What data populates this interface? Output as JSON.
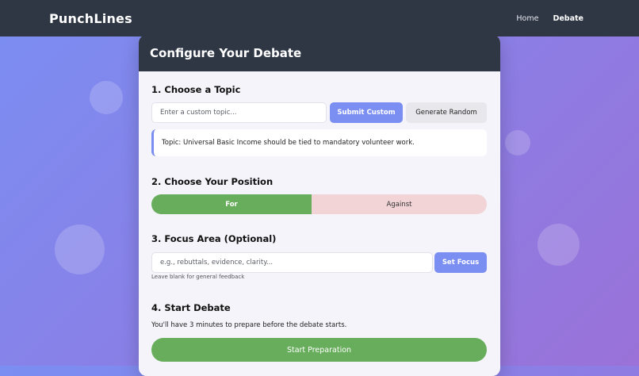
{
  "app": {
    "brand": "PunchLines",
    "nav": [
      {
        "label": "Home"
      },
      {
        "label": "Debate"
      }
    ]
  },
  "card": {
    "title": "Configure Your Debate",
    "topic_section": {
      "title": "1. Choose a Topic",
      "input_placeholder": "Enter a custom topic...",
      "input_value": "",
      "submit_label": "Submit Custom",
      "random_label": "Generate Random",
      "current_topic": "Topic: Universal Basic Income should be tied to mandatory volunteer work."
    },
    "position_section": {
      "title": "2. Choose Your Position",
      "for_label": "For",
      "against_label": "Against",
      "selected": "For"
    },
    "focus_section": {
      "title": "3. Focus Area (Optional)",
      "input_placeholder": "e.g., rebuttals, evidence, clarity...",
      "input_value": "",
      "set_label": "Set Focus",
      "hint": "Leave blank for general feedback"
    },
    "start_section": {
      "title": "4. Start Debate",
      "description": "You'll have 3 minutes to prepare before the debate starts.",
      "start_label": "Start Preparation"
    }
  },
  "colors": {
    "accent": "#7b8ef2",
    "header_dark": "#2f3644",
    "for_green": "#67ad5b",
    "against_pink": "#f2d3d6"
  }
}
